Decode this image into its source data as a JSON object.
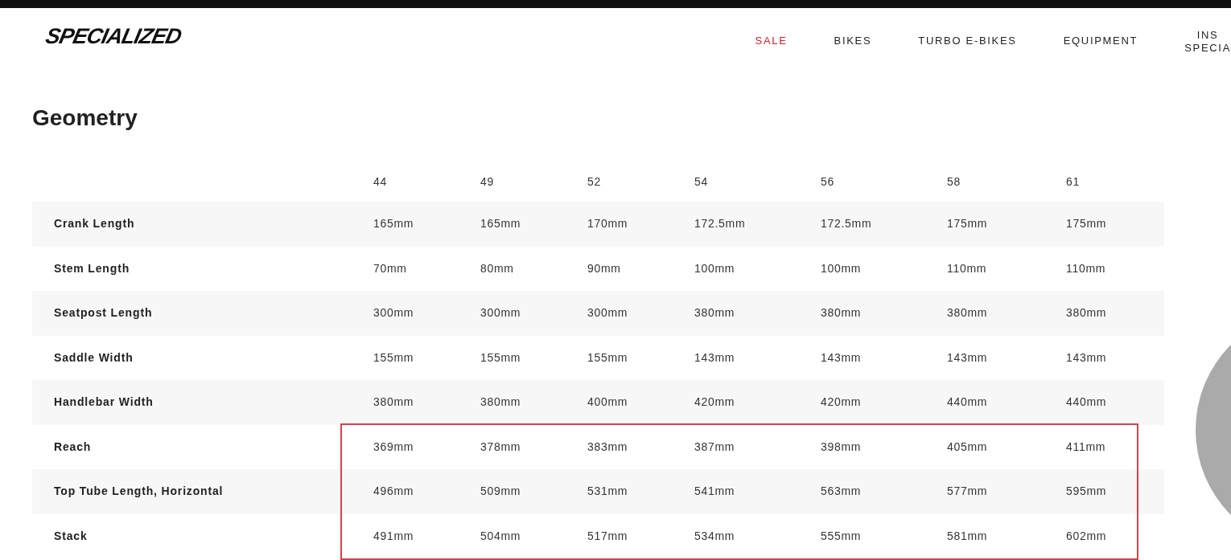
{
  "header": {
    "logo": "SPECIALIZED",
    "nav": [
      {
        "label": "SALE",
        "selected": true
      },
      {
        "label": "BIKES",
        "selected": false
      },
      {
        "label": "TURBO E-BIKES",
        "selected": false
      },
      {
        "label": "EQUIPMENT",
        "selected": false
      },
      {
        "label": "INS\nSPECIA",
        "selected": false
      }
    ]
  },
  "title": "Geometry",
  "table": {
    "columns": [
      "44",
      "49",
      "52",
      "54",
      "56",
      "58",
      "61"
    ],
    "rows": [
      {
        "label": "Crank Length",
        "highlighted": false,
        "values": [
          "165mm",
          "165mm",
          "170mm",
          "172.5mm",
          "172.5mm",
          "175mm",
          "175mm"
        ]
      },
      {
        "label": "Stem Length",
        "highlighted": false,
        "values": [
          "70mm",
          "80mm",
          "90mm",
          "100mm",
          "100mm",
          "110mm",
          "110mm"
        ]
      },
      {
        "label": "Seatpost Length",
        "highlighted": false,
        "values": [
          "300mm",
          "300mm",
          "300mm",
          "380mm",
          "380mm",
          "380mm",
          "380mm"
        ]
      },
      {
        "label": "Saddle Width",
        "highlighted": false,
        "values": [
          "155mm",
          "155mm",
          "155mm",
          "143mm",
          "143mm",
          "143mm",
          "143mm"
        ]
      },
      {
        "label": "Handlebar Width",
        "highlighted": false,
        "values": [
          "380mm",
          "380mm",
          "400mm",
          "420mm",
          "420mm",
          "440mm",
          "440mm"
        ]
      },
      {
        "label": "Reach",
        "highlighted": true,
        "values": [
          "369mm",
          "378mm",
          "383mm",
          "387mm",
          "398mm",
          "405mm",
          "411mm"
        ]
      },
      {
        "label": "Top Tube Length, Horizontal",
        "highlighted": true,
        "values": [
          "496mm",
          "509mm",
          "531mm",
          "541mm",
          "563mm",
          "577mm",
          "595mm"
        ]
      },
      {
        "label": "Stack",
        "highlighted": true,
        "values": [
          "491mm",
          "504mm",
          "517mm",
          "534mm",
          "555mm",
          "581mm",
          "602mm"
        ]
      }
    ]
  }
}
